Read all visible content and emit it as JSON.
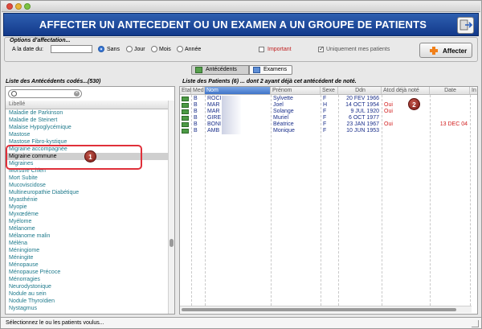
{
  "header": {
    "title": "AFFECTER UN ANTECEDENT OU UN EXAMEN A UN GROUPE DE PATIENTS"
  },
  "options": {
    "group_title": "Options d'affectation...",
    "date_label": "A la date du:",
    "date_value": "",
    "radios": [
      {
        "label": "Sans",
        "checked": true
      },
      {
        "label": "Jour",
        "checked": false
      },
      {
        "label": "Mois",
        "checked": false
      },
      {
        "label": "Année",
        "checked": false
      }
    ],
    "important_label": "Important",
    "only_my_patients_label": "Uniquement mes patients",
    "affect_button": "Affecter"
  },
  "tabs": [
    {
      "label": "Antécédents",
      "active": true
    },
    {
      "label": "Examens",
      "active": false
    }
  ],
  "left_panel": {
    "title": "Liste des Antécédents codés...(530)",
    "search_placeholder": "",
    "column": "Libellé",
    "items": [
      "Maladie de Parkinson",
      "Maladie de Steinert",
      "Malaise Hypoglycémique",
      "Mastose",
      "Mastose Fibro-kystique",
      "Migraine accompagnée",
      "Migraine commune",
      "Migraines",
      "Morsure Chien",
      "Mort Subite",
      "Mucoviscidose",
      "Multineuropathie Diabétique",
      "Myasthénie",
      "Myopie",
      "Myxœdème",
      "Myélome",
      "Mélanome",
      "Mélanome malin",
      "Méléna",
      "Méningiome",
      "Méningite",
      "Ménopause",
      "Ménopause Précoce",
      "Ménorragies",
      "Neurodystonique",
      "Nodule au sein",
      "Nodule Thyroïdien",
      "Nystagmus"
    ],
    "selected_index": 6
  },
  "right_panel": {
    "title": "Liste des Patients (6) ... dont 2 ayant déjà cet antécédent de noté.",
    "columns": [
      "Etat",
      "Med",
      "Nom",
      "Prénom",
      "Sexe",
      "Ddn",
      "Atcd déjà noté",
      "Date",
      "In"
    ],
    "rows": [
      {
        "med": "B",
        "nom": "ROCI",
        "prenom": "Sylvette",
        "sexe": "F",
        "ddn": "20 FEV 1966",
        "atcd": "",
        "date": ""
      },
      {
        "med": "B",
        "nom": "MAR",
        "prenom": "Joel",
        "sexe": "H",
        "ddn": "14 OCT 1954",
        "atcd": "Oui",
        "date": ""
      },
      {
        "med": "B",
        "nom": "MAR",
        "prenom": "Solange",
        "sexe": "F",
        "ddn": "9 JUL 1920",
        "atcd": "Oui",
        "date": ""
      },
      {
        "med": "B",
        "nom": "GIRE",
        "prenom": "Muriel",
        "sexe": "F",
        "ddn": "6 OCT 1977",
        "atcd": "",
        "date": ""
      },
      {
        "med": "B",
        "nom": "BONI",
        "prenom": "Béatrice",
        "sexe": "F",
        "ddn": "23 JAN 1967",
        "atcd": "Oui",
        "date": "13 DEC 04"
      },
      {
        "med": "B",
        "nom": "AMB",
        "prenom": "Monique",
        "sexe": "F",
        "ddn": "10 JUN 1953",
        "atcd": "",
        "date": ""
      }
    ]
  },
  "callouts": [
    "1",
    "2"
  ],
  "status": {
    "text": "Sélectionnez le ou les patients voulus..."
  },
  "colors": {
    "banner": "#1f4ea0",
    "item_text": "#1f7a8c",
    "alert": "#d21e1e",
    "accent": "#3b78d6"
  }
}
